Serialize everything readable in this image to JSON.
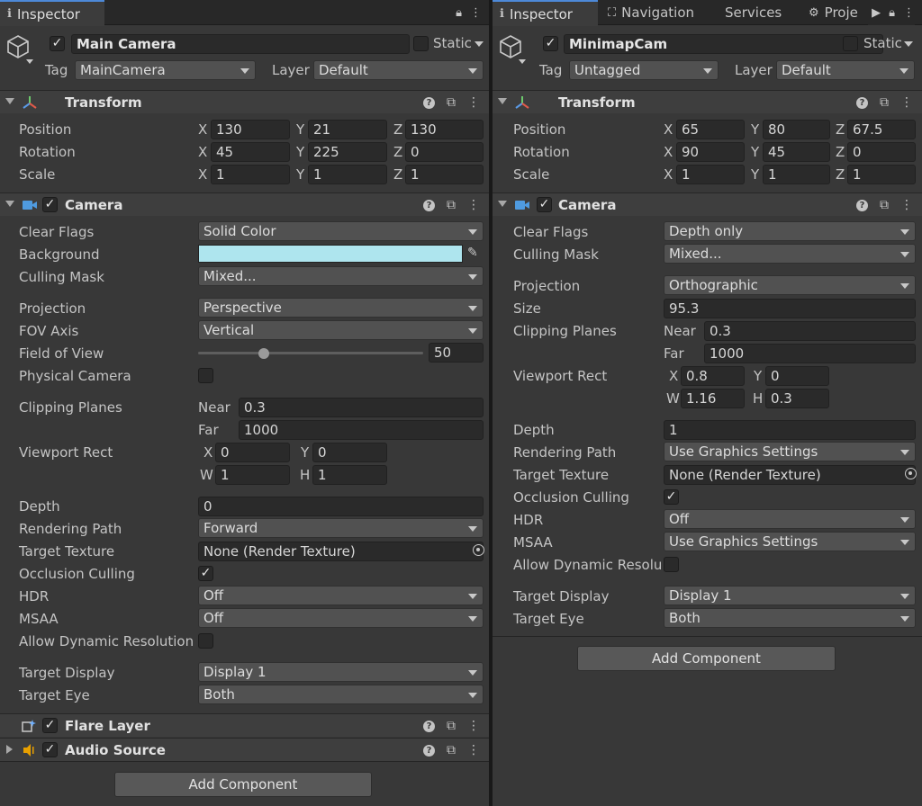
{
  "left": {
    "tab": "Inspector",
    "object": {
      "name": "Main Camera",
      "static_label": "Static",
      "tag_label": "Tag",
      "tag": "MainCamera",
      "layer_label": "Layer",
      "layer": "Default"
    },
    "transform": {
      "title": "Transform",
      "position_label": "Position",
      "rotation_label": "Rotation",
      "scale_label": "Scale",
      "position": {
        "x": "130",
        "y": "21",
        "z": "130"
      },
      "rotation": {
        "x": "45",
        "y": "225",
        "z": "0"
      },
      "scale": {
        "x": "1",
        "y": "1",
        "z": "1"
      }
    },
    "camera": {
      "title": "Camera",
      "clear_flags_label": "Clear Flags",
      "clear_flags": "Solid Color",
      "background_label": "Background",
      "background_color": "#aee5ee",
      "culling_mask_label": "Culling Mask",
      "culling_mask": "Mixed...",
      "projection_label": "Projection",
      "projection": "Perspective",
      "fov_axis_label": "FOV Axis",
      "fov_axis": "Vertical",
      "fov_label": "Field of View",
      "fov": "50",
      "fov_slider_fraction": 0.29,
      "physical_camera_label": "Physical Camera",
      "clipping_label": "Clipping Planes",
      "near_label": "Near",
      "near": "0.3",
      "far_label": "Far",
      "far": "1000",
      "viewport_label": "Viewport Rect",
      "vx": "0",
      "vy": "0",
      "vw": "1",
      "vh": "1",
      "depth_label": "Depth",
      "depth": "0",
      "rendering_path_label": "Rendering Path",
      "rendering_path": "Forward",
      "target_texture_label": "Target Texture",
      "target_texture": "None (Render Texture)",
      "occlusion_label": "Occlusion Culling",
      "hdr_label": "HDR",
      "hdr": "Off",
      "msaa_label": "MSAA",
      "msaa": "Off",
      "dynamic_res_label": "Allow Dynamic Resolution",
      "target_display_label": "Target Display",
      "target_display": "Display 1",
      "target_eye_label": "Target Eye",
      "target_eye": "Both"
    },
    "flare_layer": "Flare Layer",
    "audio_source": "Audio Source",
    "add_component": "Add Component"
  },
  "right": {
    "tabs": [
      "Inspector",
      "Navigation",
      "Services",
      "Proje"
    ],
    "object": {
      "name": "MinimapCam",
      "static_label": "Static",
      "tag_label": "Tag",
      "tag": "Untagged",
      "layer_label": "Layer",
      "layer": "Default"
    },
    "transform": {
      "title": "Transform",
      "position_label": "Position",
      "rotation_label": "Rotation",
      "scale_label": "Scale",
      "position": {
        "x": "65",
        "y": "80",
        "z": "67.5"
      },
      "rotation": {
        "x": "90",
        "y": "45",
        "z": "0"
      },
      "scale": {
        "x": "1",
        "y": "1",
        "z": "1"
      }
    },
    "camera": {
      "title": "Camera",
      "clear_flags_label": "Clear Flags",
      "clear_flags": "Depth only",
      "culling_mask_label": "Culling Mask",
      "culling_mask": "Mixed...",
      "projection_label": "Projection",
      "projection": "Orthographic",
      "size_label": "Size",
      "size": "95.3",
      "clipping_label": "Clipping Planes",
      "near_label": "Near",
      "near": "0.3",
      "far_label": "Far",
      "far": "1000",
      "viewport_label": "Viewport Rect",
      "vx": "0.8",
      "vy": "0",
      "vw": "1.16",
      "vh": "0.3",
      "depth_label": "Depth",
      "depth": "1",
      "rendering_path_label": "Rendering Path",
      "rendering_path": "Use Graphics Settings",
      "target_texture_label": "Target Texture",
      "target_texture": "None (Render Texture)",
      "occlusion_label": "Occlusion Culling",
      "hdr_label": "HDR",
      "hdr": "Off",
      "msaa_label": "MSAA",
      "msaa": "Use Graphics Settings",
      "dynamic_res_label": "Allow Dynamic Resolut",
      "target_display_label": "Target Display",
      "target_display": "Display 1",
      "target_eye_label": "Target Eye",
      "target_eye": "Both"
    },
    "add_component": "Add Component"
  },
  "axes": {
    "x": "X",
    "y": "Y",
    "z": "Z",
    "w": "W",
    "h": "H"
  },
  "colors": {
    "active_tab_accent": "#4d89d8",
    "panel_bg": "#383838",
    "field_bg": "#2a2a2a"
  }
}
